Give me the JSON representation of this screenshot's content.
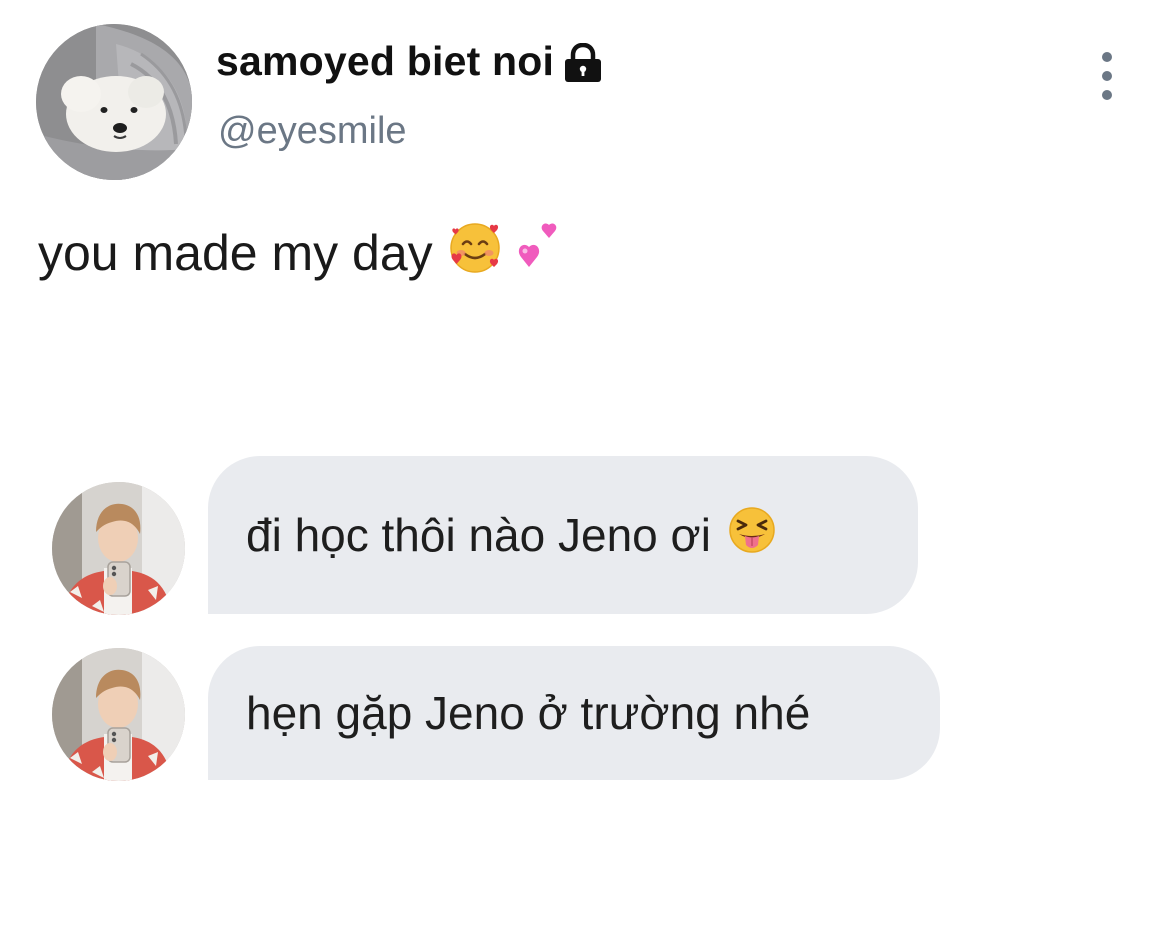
{
  "tweet": {
    "display_name": "samoyed biet noi",
    "handle": "@eyesmile",
    "text": "you made my day",
    "text_emojis": [
      "smiling-face-with-hearts",
      "two-hearts"
    ]
  },
  "messages": [
    {
      "text": "đi học thôi nào Jeno ơi",
      "emoji": "squinting-face-with-tongue"
    },
    {
      "text": "hẹn gặp Jeno ở trường nhé"
    }
  ],
  "colors": {
    "bubble_bg": "#e9ebef",
    "secondary_text": "#6b7785",
    "primary_text": "#111111"
  }
}
